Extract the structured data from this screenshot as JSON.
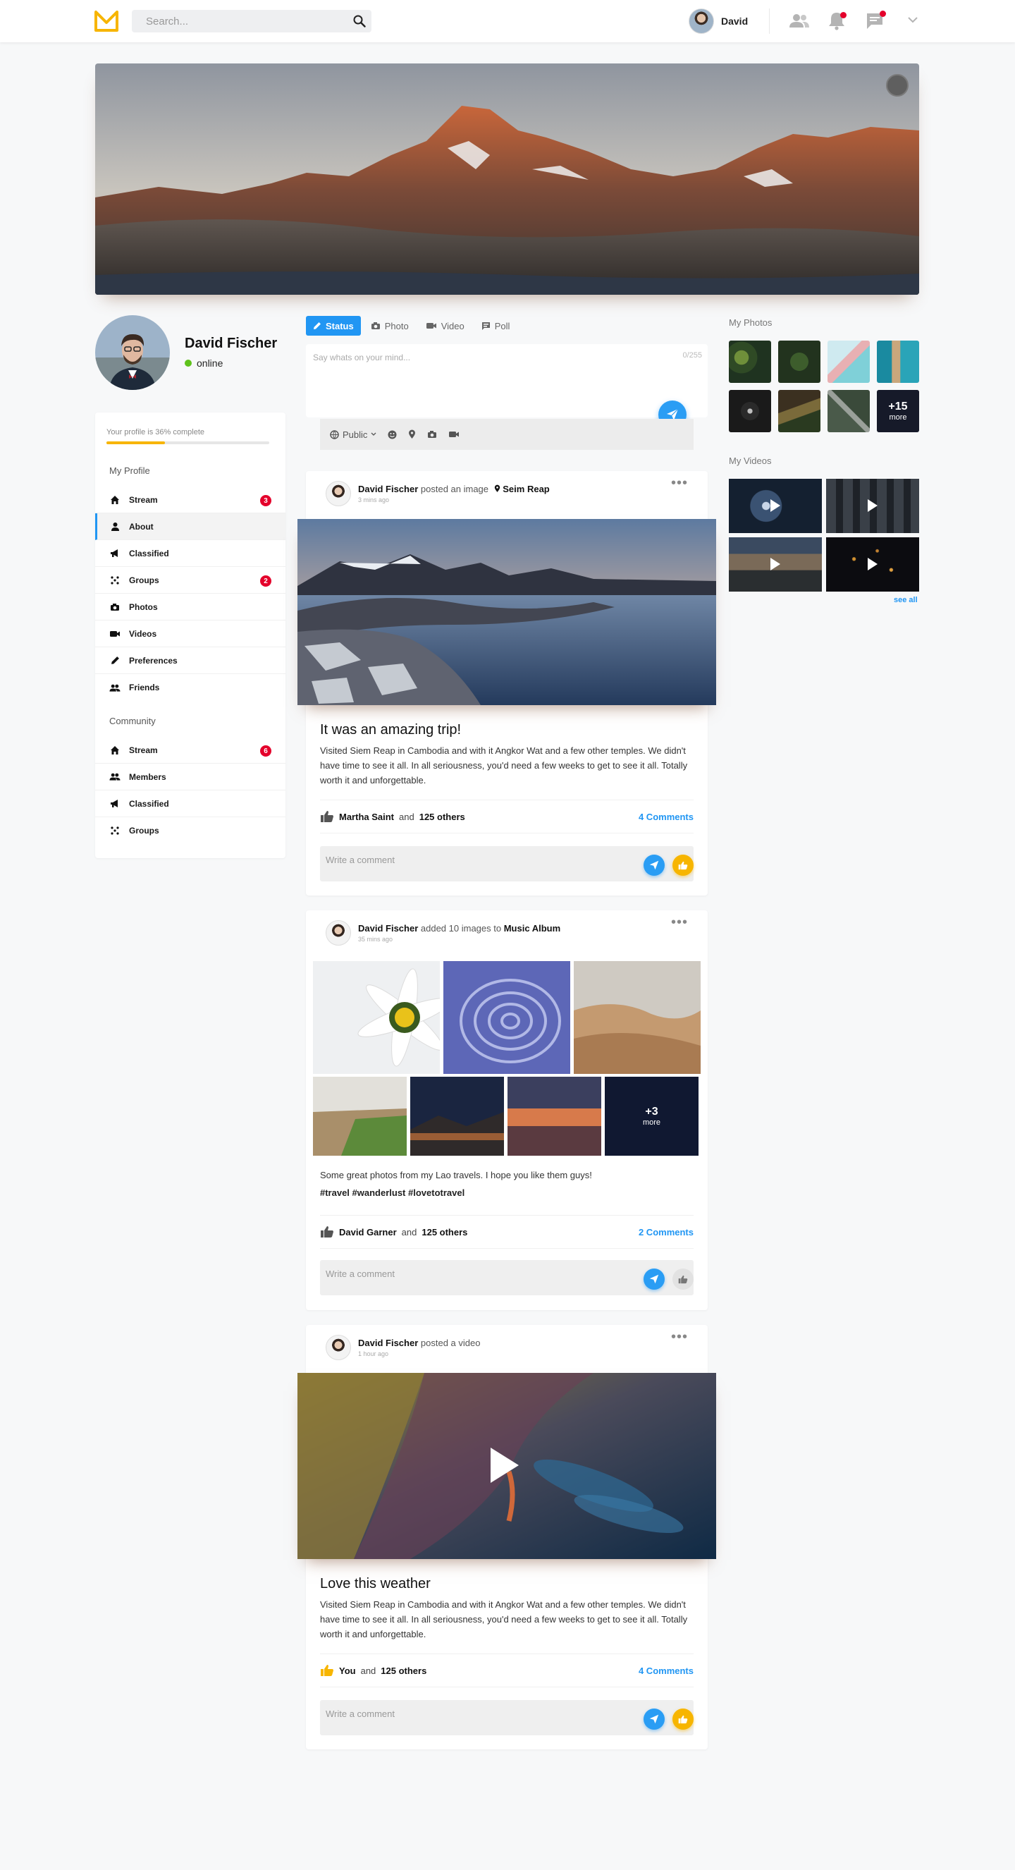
{
  "header": {
    "search_placeholder": "Search...",
    "user_name": "David",
    "brand_color": "#f7b500",
    "icons": [
      "users-icon",
      "bell-icon",
      "chat-icon",
      "chevron-down-icon"
    ]
  },
  "profile": {
    "name": "David Fischer",
    "status": "online",
    "completion_text": "Your profile is 36% complete",
    "completion_percent": 36
  },
  "sidebar": {
    "my_profile_heading": "My Profile",
    "my_profile_items": [
      {
        "label": "Stream",
        "icon": "home-icon",
        "badge": "3"
      },
      {
        "label": "About",
        "icon": "user-icon",
        "badge": ""
      },
      {
        "label": "Classified",
        "icon": "megaphone-icon",
        "badge": ""
      },
      {
        "label": "Groups",
        "icon": "groups-icon",
        "badge": "2"
      },
      {
        "label": "Photos",
        "icon": "camera-icon",
        "badge": ""
      },
      {
        "label": "Videos",
        "icon": "video-icon",
        "badge": ""
      },
      {
        "label": "Preferences",
        "icon": "pencil-icon",
        "badge": ""
      },
      {
        "label": "Friends",
        "icon": "friends-icon",
        "badge": ""
      }
    ],
    "community_heading": "Community",
    "community_items": [
      {
        "label": "Stream",
        "icon": "home-icon",
        "badge": "6"
      },
      {
        "label": "Members",
        "icon": "friends-icon",
        "badge": ""
      },
      {
        "label": "Classified",
        "icon": "megaphone-icon",
        "badge": ""
      },
      {
        "label": "Groups",
        "icon": "groups-icon",
        "badge": ""
      }
    ]
  },
  "composer": {
    "tabs": [
      "Status",
      "Photo",
      "Video",
      "Poll"
    ],
    "placeholder": "Say whats on your mind...",
    "counter": "0/255",
    "privacy": "Public"
  },
  "posts": [
    {
      "author": "David Fischer",
      "action": "posted an image",
      "location": "Seim Reap",
      "time": "3 mins ago",
      "title": "It was an amazing trip!",
      "text": "Visited Siem Reap in Cambodia and with it Angkor Wat and a few other temples. We didn't have time to see it all. In all seriousness, you'd need a few weeks to get to see it all. Totally worth it and unforgettable.",
      "liker": "Martha Saint",
      "and_text": "and",
      "others": "125 others",
      "comments": "4 Comments",
      "comment_placeholder": "Write a comment"
    },
    {
      "author": "David Fischer",
      "action": "added 10 images to",
      "album": "Music Album",
      "time": "35 mins ago",
      "text": "Some great photos from my Lao travels. I hope you like them guys!",
      "tags": "#travel #wanderlust #lovetotravel",
      "more_count": "+3",
      "more_label": "more",
      "liker": "David Garner",
      "and_text": "and",
      "others": "125 others",
      "comments": "2 Comments",
      "comment_placeholder": "Write a comment"
    },
    {
      "author": "David Fischer",
      "action": "posted a video",
      "time": "1 hour ago",
      "title": "Love this weather",
      "text": "Visited Siem Reap in Cambodia and with it Angkor Wat and a few other temples. We didn't have time to see it all. In all seriousness, you'd need a few weeks to get to see it all. Totally worth it and unforgettable.",
      "liker": "You",
      "and_text": "and",
      "others": "125 others",
      "comments": "4 Comments",
      "comment_placeholder": "Write a comment"
    }
  ],
  "right": {
    "photos_heading": "My Photos",
    "photos_more_count": "+15",
    "photos_more_label": "more",
    "videos_heading": "My Videos",
    "see_all": "see all"
  },
  "colors": {
    "accent": "#2196f3",
    "brand": "#f7b500",
    "badge": "#e4002b",
    "online": "#5fc21c"
  }
}
